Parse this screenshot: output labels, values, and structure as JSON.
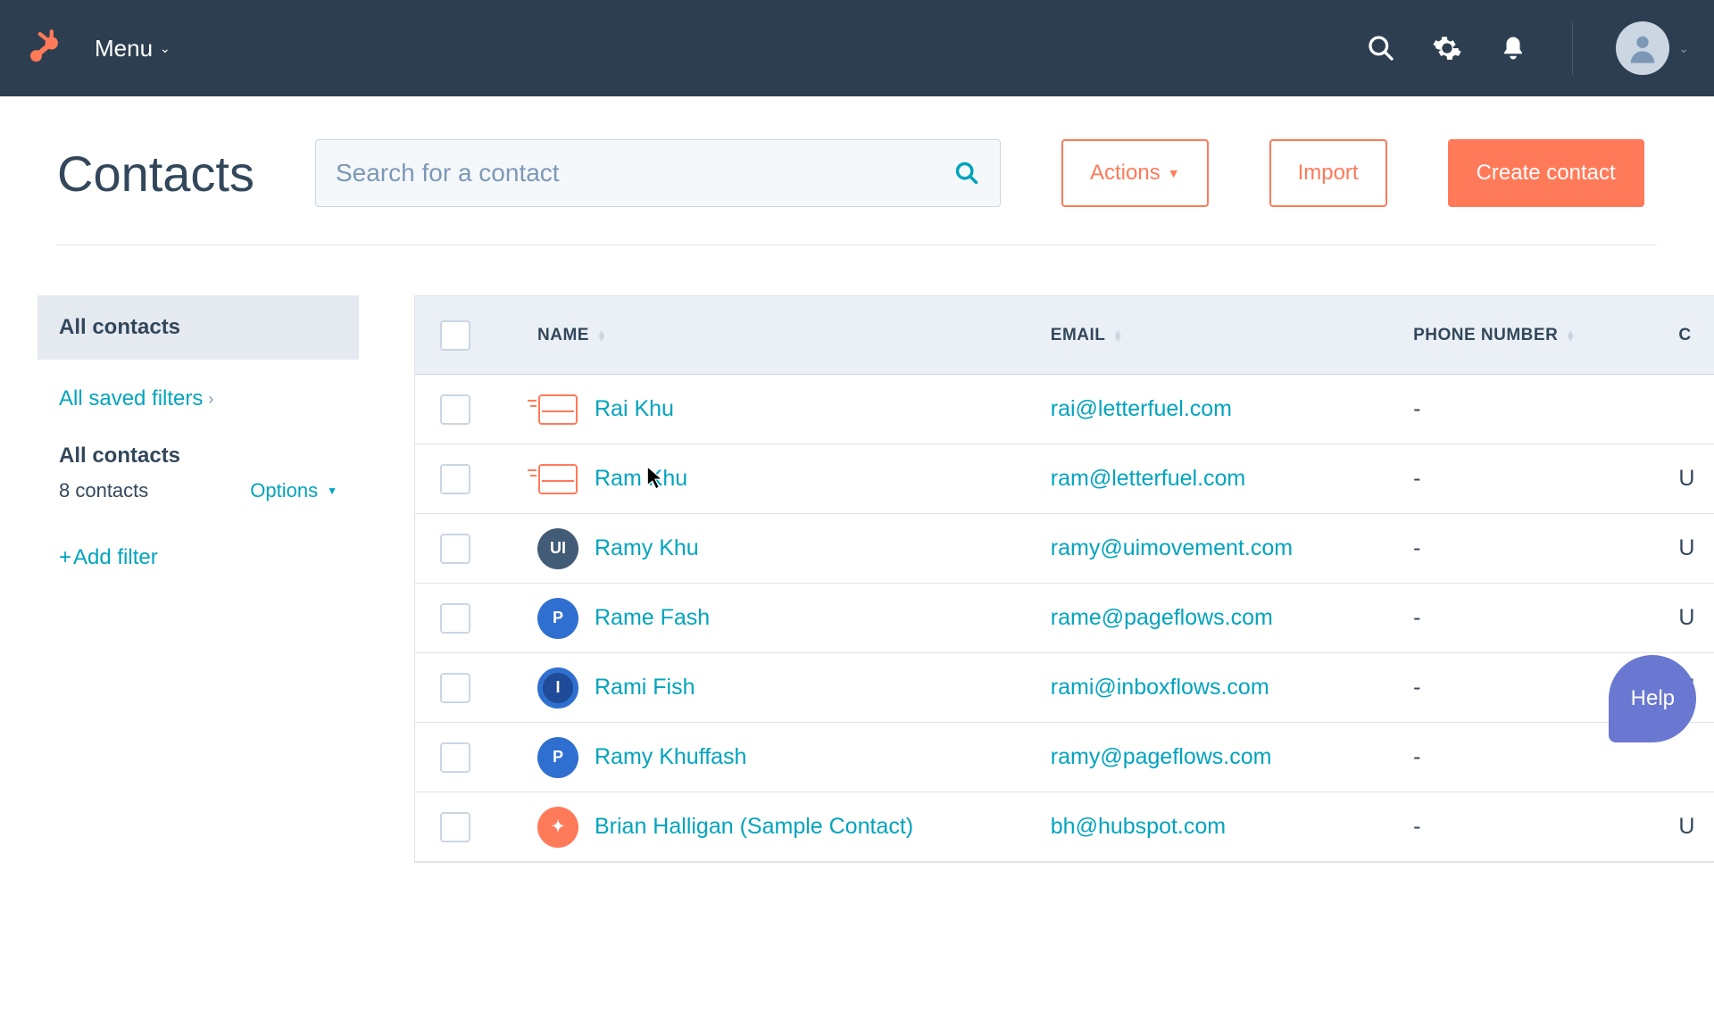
{
  "nav": {
    "menu_label": "Menu"
  },
  "header": {
    "title": "Contacts",
    "search_placeholder": "Search for a contact",
    "actions_label": "Actions",
    "import_label": "Import",
    "create_label": "Create contact"
  },
  "sidebar": {
    "active_label": "All contacts",
    "saved_filters_label": "All saved filters",
    "section_title": "All contacts",
    "count_label": "8 contacts",
    "options_label": "Options",
    "add_filter_label": "Add filter"
  },
  "table": {
    "columns": {
      "name": "NAME",
      "email": "EMAIL",
      "phone": "PHONE NUMBER",
      "extra": "C"
    },
    "rows": [
      {
        "name": "Rai Khu",
        "email": "rai@letterfuel.com",
        "phone": "-",
        "extra": "",
        "icon_type": "mail"
      },
      {
        "name": "Ram Khu",
        "email": "ram@letterfuel.com",
        "phone": "-",
        "extra": "U",
        "icon_type": "mail"
      },
      {
        "name": "Ramy Khu",
        "email": "ramy@uimovement.com",
        "phone": "-",
        "extra": "U",
        "icon_type": "ui",
        "icon_text": "UI"
      },
      {
        "name": "Rame Fash",
        "email": "rame@pageflows.com",
        "phone": "-",
        "extra": "U",
        "icon_type": "p",
        "icon_text": "P"
      },
      {
        "name": "Rami Fish",
        "email": "rami@inboxflows.com",
        "phone": "-",
        "extra": "U",
        "icon_type": "i",
        "icon_text": "I"
      },
      {
        "name": "Ramy Khuffash",
        "email": "ramy@pageflows.com",
        "phone": "-",
        "extra": "",
        "icon_type": "p",
        "icon_text": "P"
      },
      {
        "name": "Brian Halligan (Sample Contact)",
        "email": "bh@hubspot.com",
        "phone": "-",
        "extra": "U",
        "icon_type": "hub",
        "icon_text": "✦"
      }
    ]
  },
  "help_label": "Help"
}
